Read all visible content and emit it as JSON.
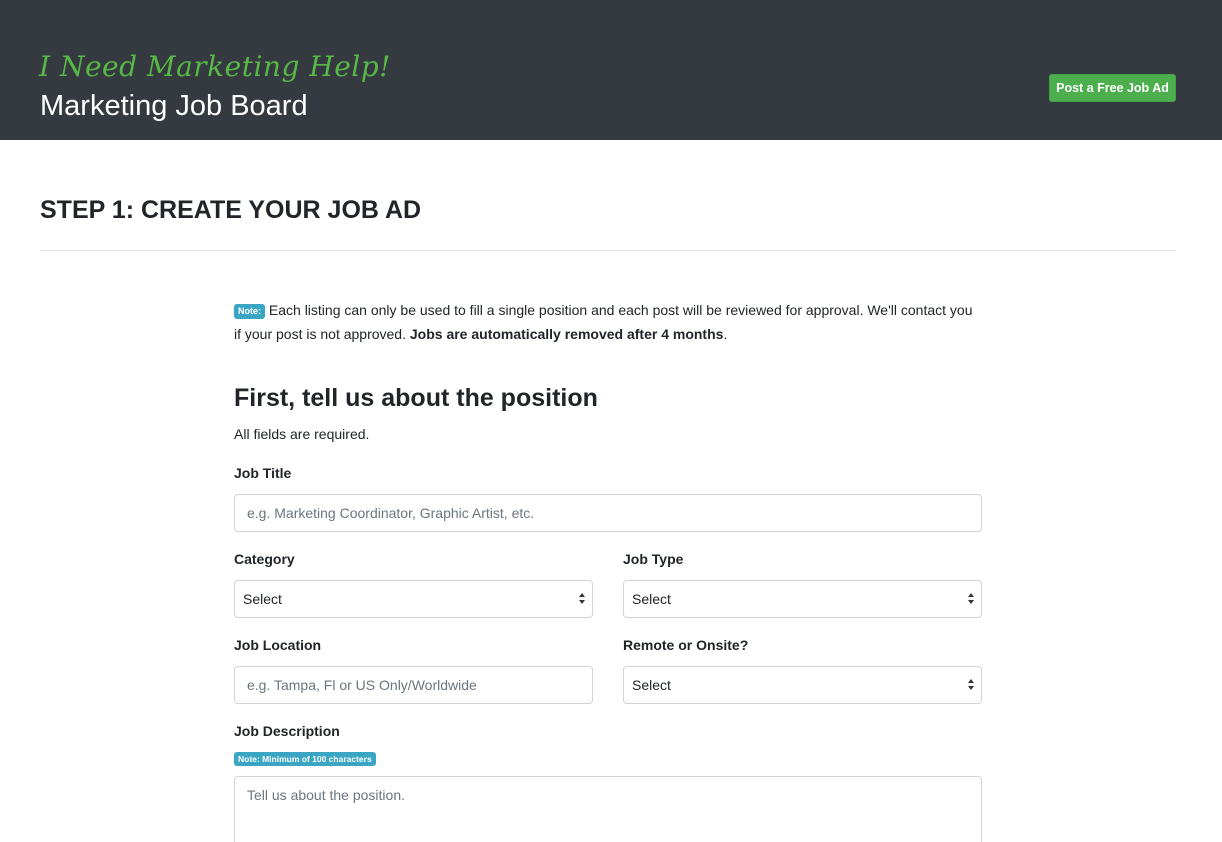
{
  "header": {
    "tagline": "I Need Marketing Help!",
    "title": "Marketing Job Board",
    "post_button": "Post a Free Job Ad"
  },
  "step_title": "STEP 1: CREATE YOUR JOB AD",
  "note": {
    "badge": "Note:",
    "text": " Each listing can only be used to fill a single position and each post will be reviewed for approval. We'll contact you if your post is not approved. ",
    "bold": "Jobs are automatically removed after 4 months",
    "end": "."
  },
  "section": {
    "title": "First, tell us about the position",
    "subtitle": "All fields are required."
  },
  "form": {
    "job_title": {
      "label": "Job Title",
      "placeholder": "e.g. Marketing Coordinator, Graphic Artist, etc."
    },
    "category": {
      "label": "Category",
      "value": "Select"
    },
    "job_type": {
      "label": "Job Type",
      "value": "Select"
    },
    "job_location": {
      "label": "Job Location",
      "placeholder": "e.g. Tampa, Fl or US Only/Worldwide"
    },
    "remote": {
      "label": "Remote or Onsite?",
      "value": "Select"
    },
    "description": {
      "label": "Job Description",
      "note": "Note: Minimum of 100 characters",
      "placeholder": "Tell us about the position."
    }
  },
  "colors": {
    "header_bg": "#343a40",
    "accent_green": "#4cae4c",
    "tagline_green": "#57b846",
    "badge_blue": "#3aa6c3"
  }
}
